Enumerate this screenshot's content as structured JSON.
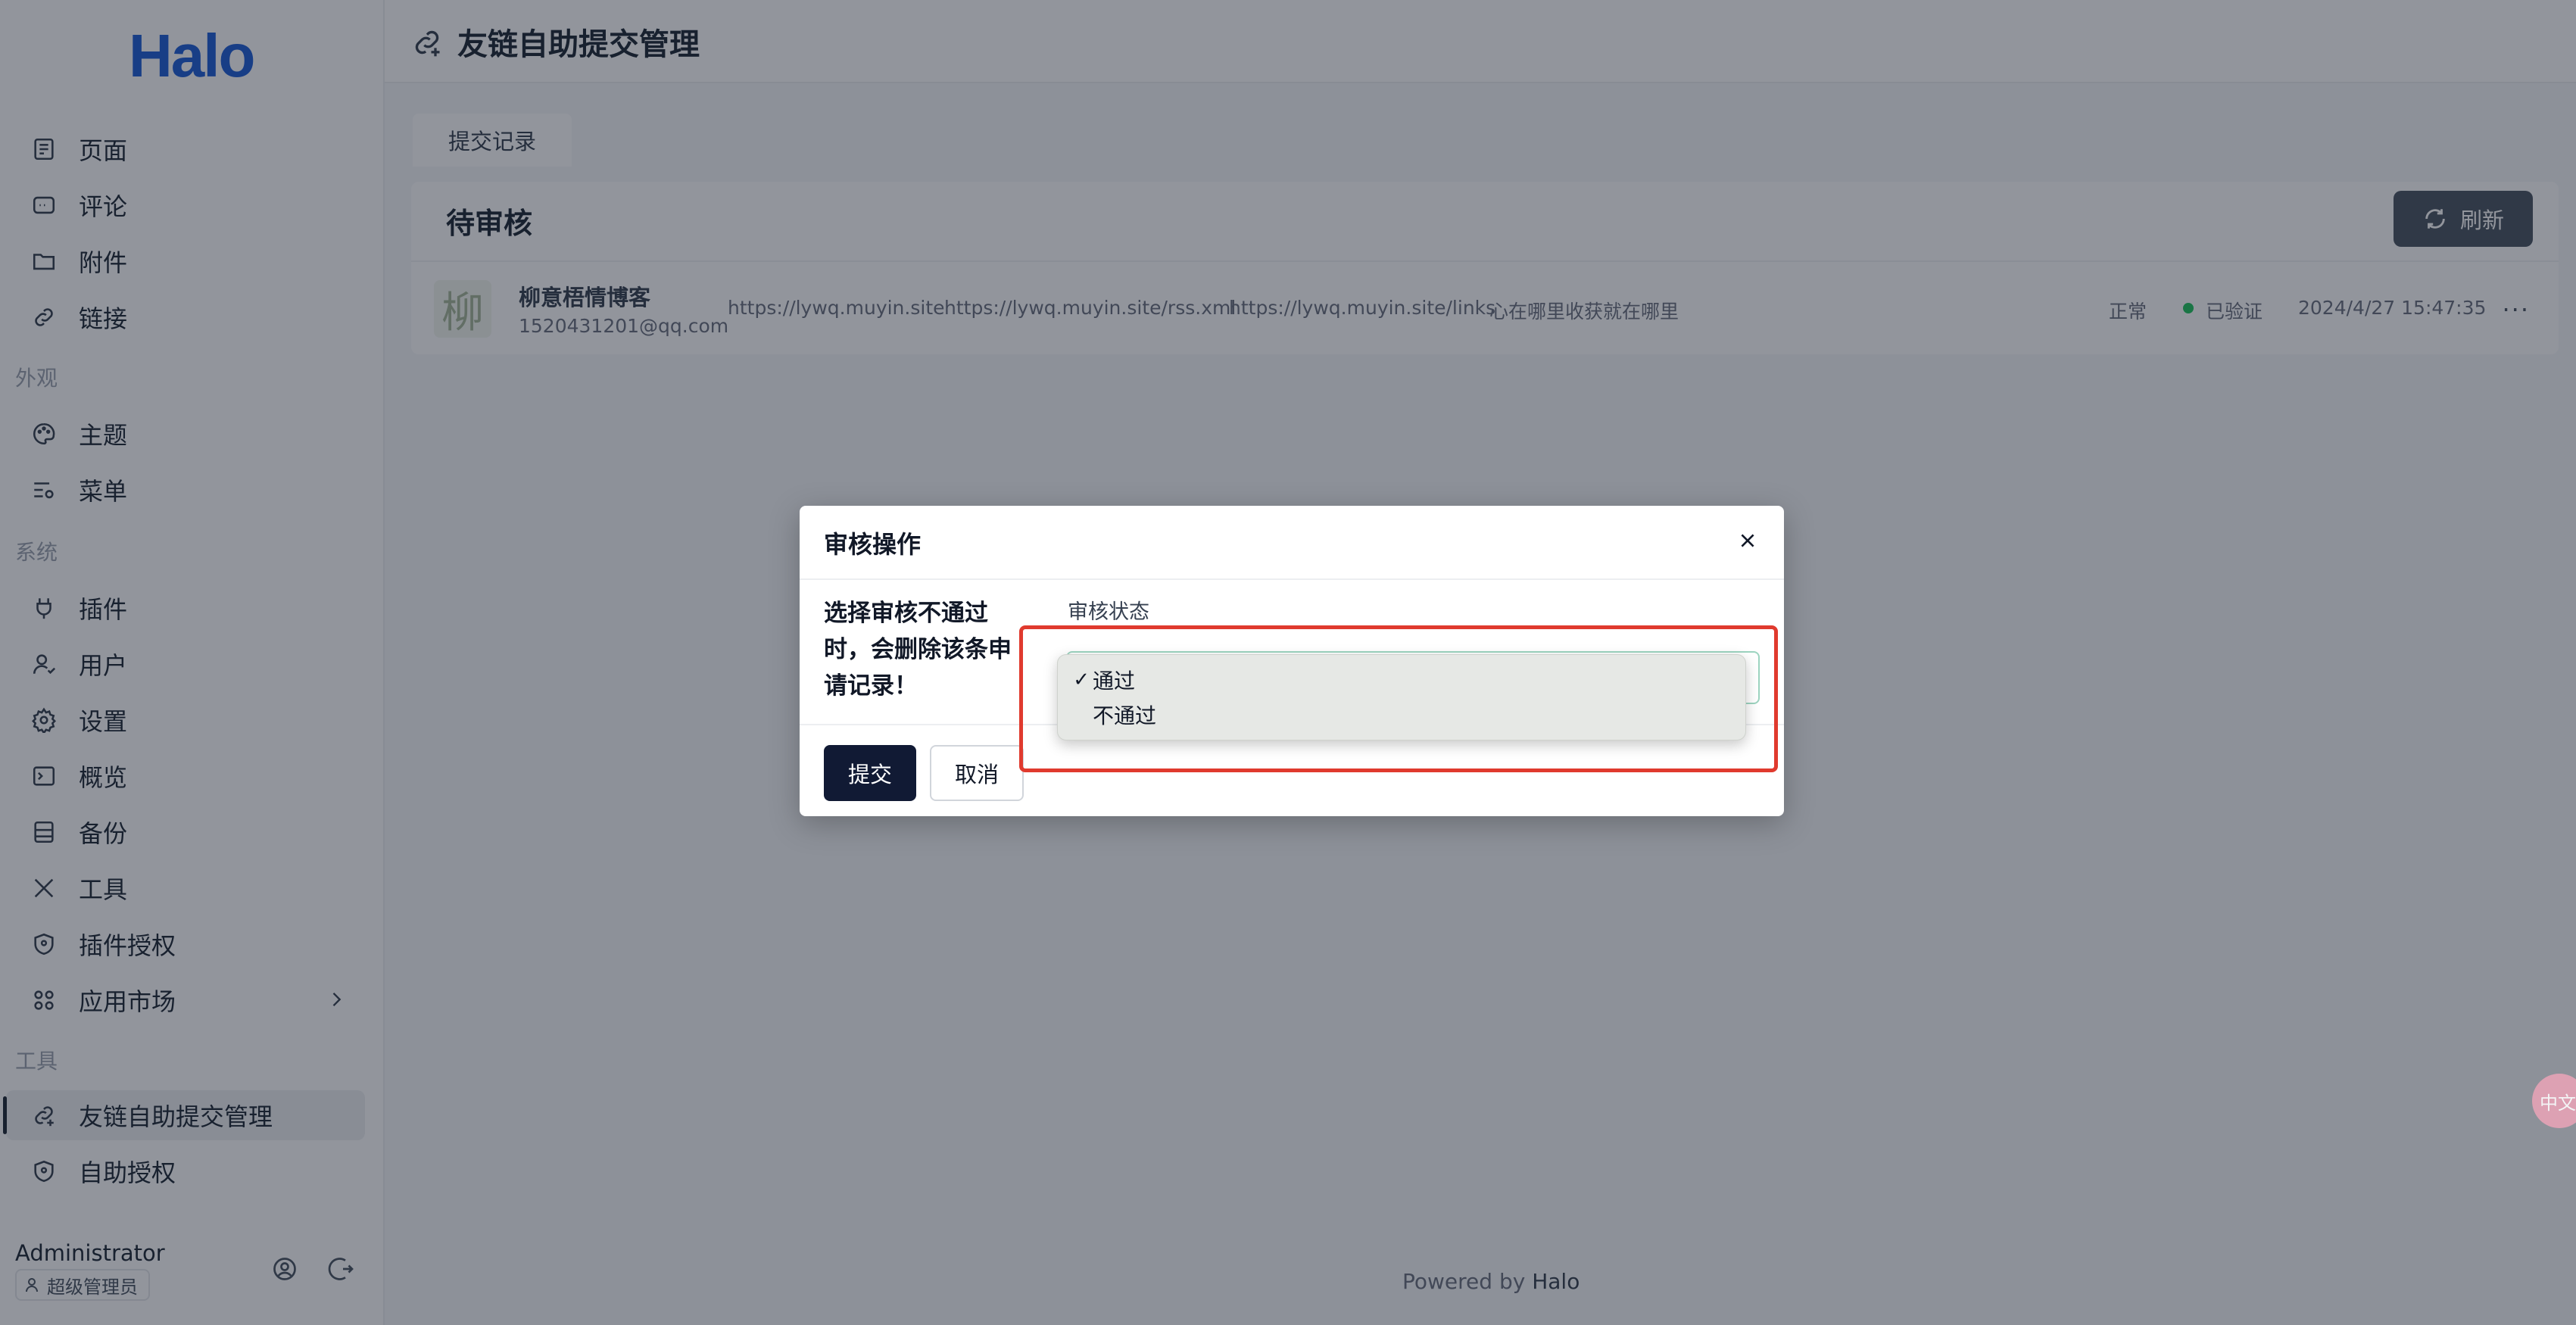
{
  "app": {
    "logo": "Halo"
  },
  "sidebar": {
    "items_top": [
      {
        "label": "页面",
        "icon": "pages-icon"
      },
      {
        "label": "评论",
        "icon": "comment-icon"
      },
      {
        "label": "附件",
        "icon": "folder-icon"
      },
      {
        "label": "链接",
        "icon": "link-icon"
      }
    ],
    "group_appearance": "外观",
    "items_appearance": [
      {
        "label": "主题",
        "icon": "palette-icon"
      },
      {
        "label": "菜单",
        "icon": "menu-settings-icon"
      }
    ],
    "group_system": "系统",
    "items_system": [
      {
        "label": "插件",
        "icon": "plug-icon"
      },
      {
        "label": "用户",
        "icon": "user-icon"
      },
      {
        "label": "设置",
        "icon": "gear-icon"
      },
      {
        "label": "概览",
        "icon": "terminal-icon"
      },
      {
        "label": "备份",
        "icon": "backup-icon"
      },
      {
        "label": "工具",
        "icon": "tools-icon"
      },
      {
        "label": "插件授权",
        "icon": "shield-icon"
      },
      {
        "label": "应用市场",
        "icon": "grid-icon"
      }
    ],
    "group_tools": "工具",
    "items_tools": [
      {
        "label": "友链自助提交管理",
        "icon": "link-add-icon",
        "active": true
      },
      {
        "label": "自助授权",
        "icon": "shield-icon"
      }
    ],
    "user": {
      "name": "Administrator",
      "role": "超级管理员"
    }
  },
  "header": {
    "title": "友链自助提交管理"
  },
  "tabs": [
    {
      "label": "提交记录"
    }
  ],
  "card": {
    "title": "待审核",
    "refresh_label": "刷新",
    "row": {
      "avatar_char": "柳",
      "name": "柳意梧情博客",
      "email": "1520431201@qq.com",
      "site_url": "https://lywq.muyin.site",
      "rss_url": "https://lywq.muyin.site/rss.xml",
      "links_url": "https://lywq.muyin.site/links",
      "description": "心在哪里收获就在哪里",
      "status": "正常",
      "verify_status": "已验证",
      "verify_color": "#22c55e",
      "time": "2024/4/27 15:47:35",
      "more": "···"
    }
  },
  "footer": {
    "prefix": "Powered by",
    "brand": "Halo"
  },
  "modal": {
    "title": "审核操作",
    "warning": "选择审核不通过时，会删除该条申请记录！",
    "field_label": "审核状态",
    "submit_label": "提交",
    "cancel_label": "取消",
    "options": [
      {
        "label": "通过",
        "selected": true
      },
      {
        "label": "不通过",
        "selected": false
      }
    ],
    "checkmark": "✓"
  },
  "float_tool": {
    "label": "中文"
  },
  "colors": {
    "highlight": "#e03a2e",
    "primary": "#111a34",
    "logo": "#1f5fd6"
  }
}
